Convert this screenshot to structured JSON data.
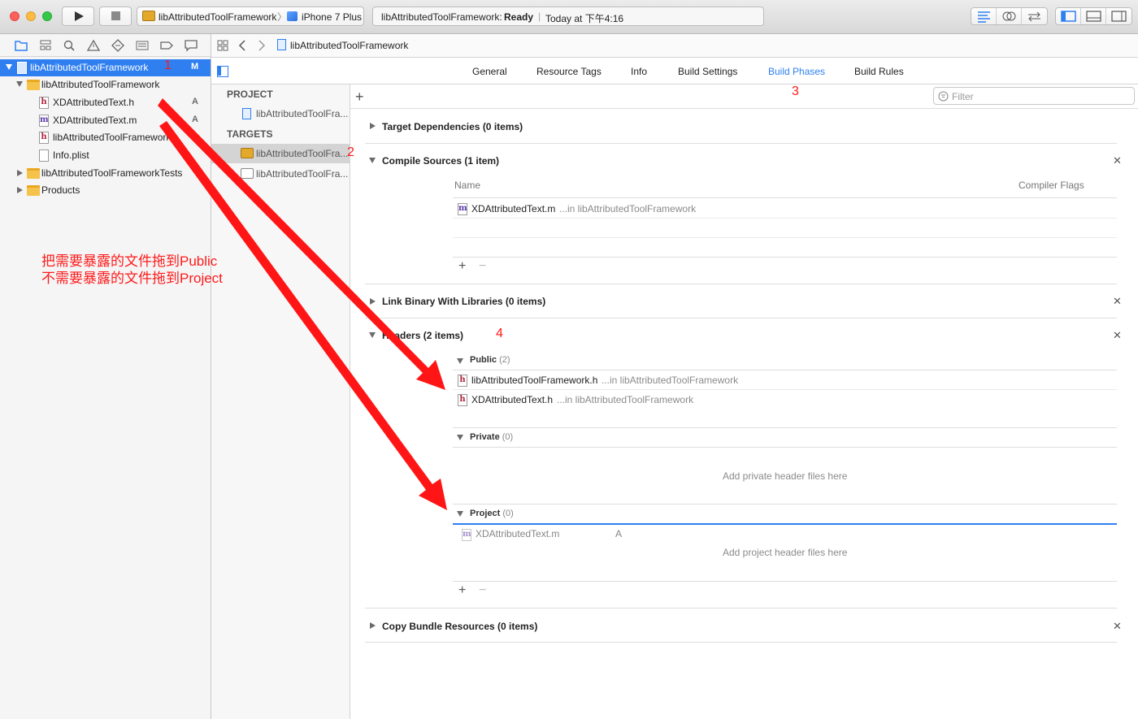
{
  "toolbar": {
    "scheme_name": "libAttributedToolFramework",
    "device_name": "iPhone 7 Plus",
    "status_project": "libAttributedToolFramework:",
    "status_state": "Ready",
    "status_time": "Today at 下午4:16"
  },
  "navigator": {
    "items": [
      {
        "label": "libAttributedToolFramework",
        "badge": "M"
      },
      {
        "label": "libAttributedToolFramework"
      },
      {
        "label": "XDAttributedText.h",
        "badge": "A"
      },
      {
        "label": "XDAttributedText.m",
        "badge": "A"
      },
      {
        "label": "libAttributedToolFramework"
      },
      {
        "label": "Info.plist"
      },
      {
        "label": "libAttributedToolFrameworkTests"
      },
      {
        "label": "Products"
      }
    ]
  },
  "jumpbar": {
    "path": "libAttributedToolFramework"
  },
  "tabs": {
    "general": "General",
    "resource_tags": "Resource Tags",
    "info": "Info",
    "build_settings": "Build Settings",
    "build_phases": "Build Phases",
    "build_rules": "Build Rules"
  },
  "filter": {
    "placeholder": "Filter"
  },
  "targets_panel": {
    "project_header": "PROJECT",
    "project_item": "libAttributedToolFra...",
    "targets_header": "TARGETS",
    "target_1": "libAttributedToolFra...",
    "target_2": "libAttributedToolFra..."
  },
  "phases": {
    "dependencies_title": "Target Dependencies (0 items)",
    "compile_title": "Compile Sources (1 item)",
    "compile_col_name": "Name",
    "compile_col_flags": "Compiler Flags",
    "compile_file": "XDAttributedText.m",
    "compile_file_path": "...in libAttributedToolFramework",
    "link_title": "Link Binary With Libraries (0 items)",
    "headers_title": "Headers (2 items)",
    "public_label": "Public",
    "public_count": "(2)",
    "public_file_1": "libAttributedToolFramework.h",
    "public_file_1_path": "...in libAttributedToolFramework",
    "public_file_2": "XDAttributedText.h",
    "public_file_2_path": "...in libAttributedToolFramework",
    "private_label": "Private",
    "private_count": "(0)",
    "private_placeholder": "Add private header files here",
    "project_label": "Project",
    "project_count": "(0)",
    "drag_file": "XDAttributedText.m",
    "drag_badge": "A",
    "project_placeholder": "Add project header files here",
    "copy_title": "Copy Bundle Resources (0 items)"
  },
  "annotations": {
    "n1": "1",
    "n2": "2",
    "n3": "3",
    "n4": "4",
    "note_line1": "把需要暴露的文件拖到Public",
    "note_line2": "不需要暴露的文件拖到Project"
  },
  "colors": {
    "accent": "#2f7ff0",
    "annotation": "#ff1a1a",
    "selection": "#2f7ff0"
  }
}
